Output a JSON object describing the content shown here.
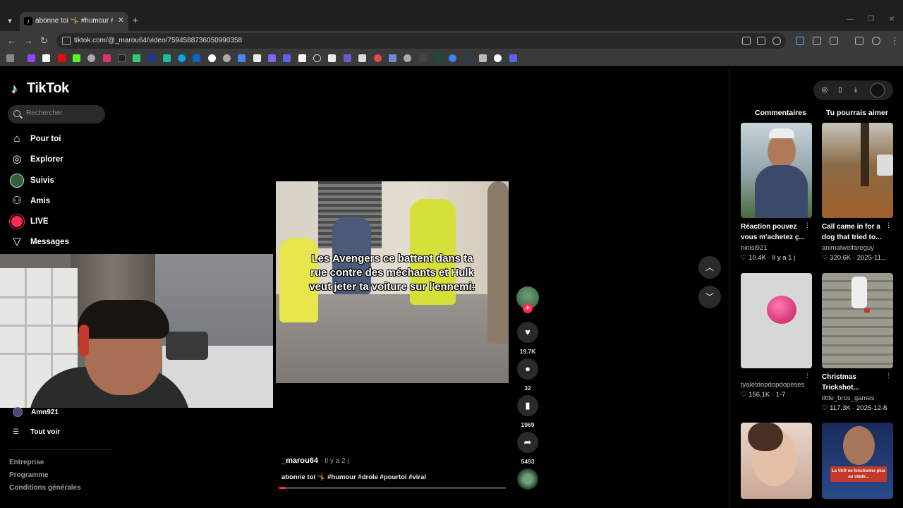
{
  "browser": {
    "tab_title": "abonne toi 🤸 #humour #drole",
    "url": "tiktok.com/@_marou64/video/7594588736050990358"
  },
  "sidebar": {
    "logo": "TikTok",
    "search_placeholder": "Rechercher",
    "nav": [
      {
        "label": "Pour toi",
        "icon": "home-icon"
      },
      {
        "label": "Explorer",
        "icon": "compass-icon"
      },
      {
        "label": "Suivis",
        "icon": "following-avatar-icon"
      },
      {
        "label": "Amis",
        "icon": "friends-icon"
      },
      {
        "label": "LIVE",
        "icon": "live-icon"
      },
      {
        "label": "Messages",
        "icon": "send-icon"
      }
    ],
    "following_user": "Amn921",
    "see_all": "Tout voir",
    "footer": [
      "Entreprise",
      "Programme",
      "Conditions générales"
    ]
  },
  "video": {
    "caption_overlay": "Les Avengers ce battent dans ta rue contre des méchants et Hulk veut jeter ta voiture sur l'ennemi:",
    "author": "_marou64",
    "time": "Il y a 2 j",
    "description": "abonne toi 🤸 #humour #drole #pourtoi #viral",
    "progress": 0.03,
    "likes": "19.7K",
    "comments": "32",
    "saves": "1969",
    "shares": "5493"
  },
  "right_panel": {
    "tab_comments": "Commentaires",
    "tab_suggested": "Tu pourrais aimer",
    "recommendations": [
      {
        "title": "Réaction pouvez vous m'achetez ç...",
        "user": "ninisi921",
        "likes": "10.4K",
        "date": "Il y a 1 j"
      },
      {
        "title": "Call came in for a dog that tried to...",
        "user": "animalwelfareguy",
        "likes": "320.6K",
        "date": "2025-11..."
      },
      {
        "title": "",
        "user": "tyaletdopdopdopeses",
        "likes": "156.1K",
        "date": "1-7"
      },
      {
        "title": "Christmas Trickshot...",
        "user": "little_bros_games",
        "likes": "117.3K",
        "date": "2025-12-8"
      },
      {
        "title": "",
        "user": "",
        "likes": "",
        "date": ""
      },
      {
        "title": "",
        "user": "",
        "likes": "",
        "date": ""
      }
    ],
    "thumb_text": "La VAR ne fonctionne plus au stade..."
  }
}
